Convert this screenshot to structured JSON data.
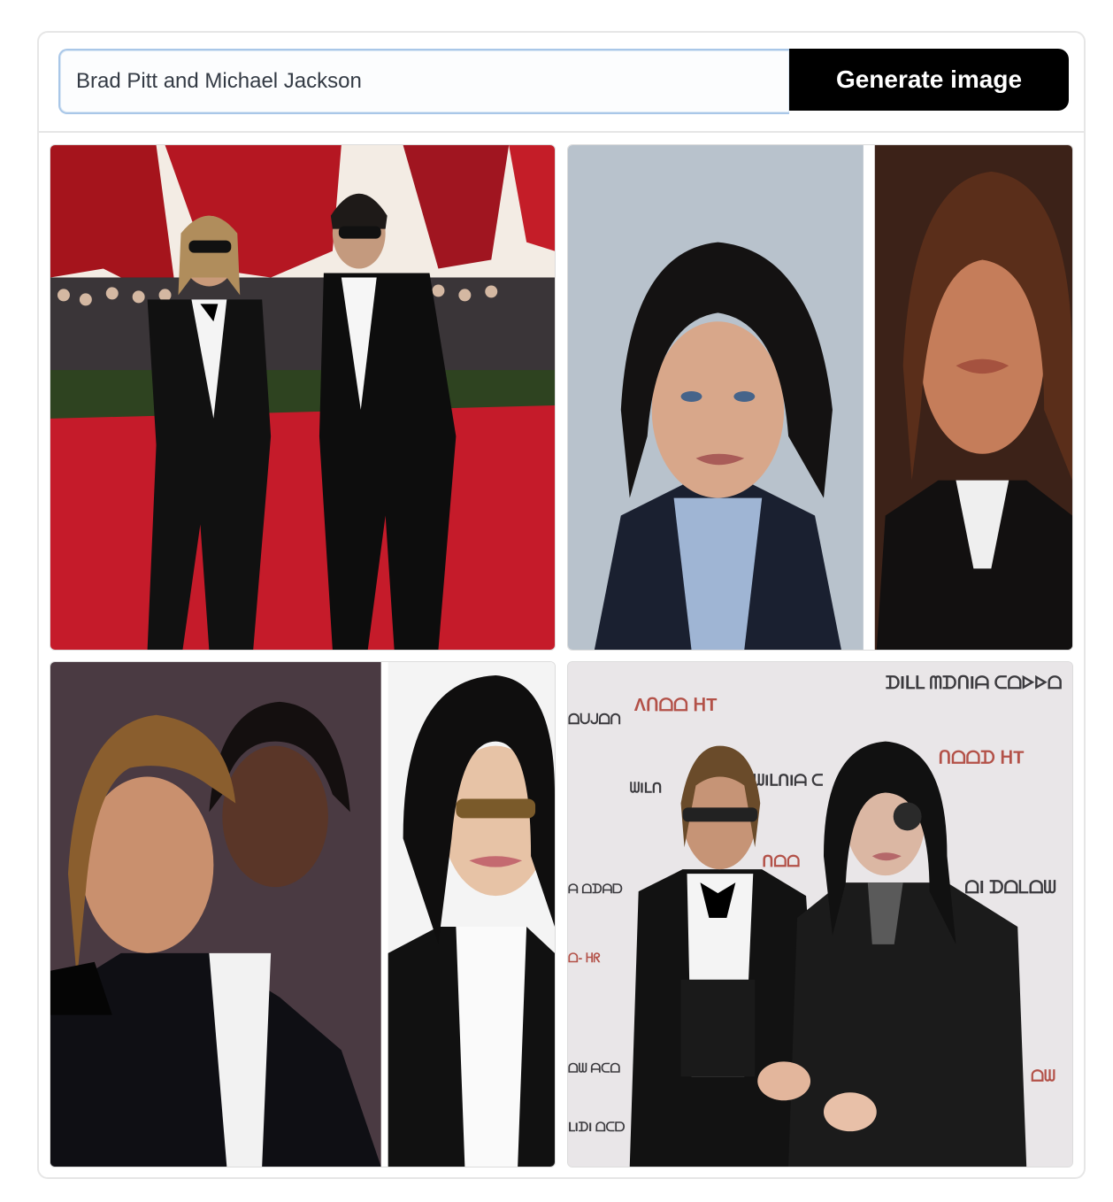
{
  "form": {
    "prompt_value": "Brad Pitt and Michael Jackson",
    "generate_label": "Generate image"
  },
  "results": [
    {
      "description_name": "generated-image-1"
    },
    {
      "description_name": "generated-image-2"
    },
    {
      "description_name": "generated-image-3"
    },
    {
      "description_name": "generated-image-4"
    }
  ],
  "image4_backdrop_text": [
    "ᗪIᒪᒪ ᗰᗪᑎIᗩ ᑕᗝᐅᐅᗝ",
    "Λᑎᗝᗝ ᕼT",
    "ᗝᑌᒍᗝᑎ",
    "ᗯIᒪᑎ",
    "ᗯIᒪᑎIᗩ ᑕ",
    "ᑎᗝᗝᗪ ᕼT",
    "ᑎᗝᗝ",
    "ᗩ ᗝᗪᗩᗞ",
    "ᗝI ᗪᗝᒪᗝᗯ",
    "ᗝ- ᕼᖇ",
    "ᗝᗯ ᗩᑕᗝ",
    "ᗝᗯ",
    "ᒪIᗪI ᗝᑕᗞ"
  ],
  "colors": {
    "button_bg": "#000000",
    "input_border": "#a9c7e8"
  }
}
